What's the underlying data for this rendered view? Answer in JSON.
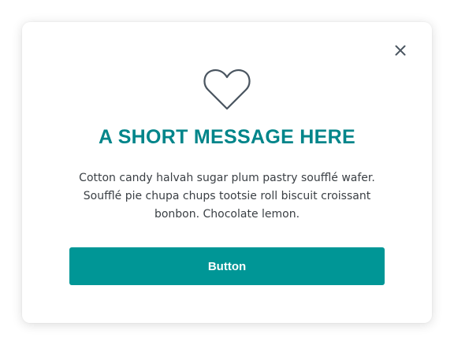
{
  "modal": {
    "close_icon": "close-icon",
    "hero_icon": "heart-icon",
    "title": "A SHORT MESSAGE HERE",
    "body": "Cotton candy halvah sugar plum pastry soufflé wafer. Soufflé pie chupa chups tootsie roll biscuit croissant bonbon. Chocolate lemon.",
    "button_label": "Button"
  },
  "colors": {
    "accent": "#00858a",
    "button_bg": "#009696",
    "icon": "#4a5560",
    "text": "#3a3f44"
  }
}
